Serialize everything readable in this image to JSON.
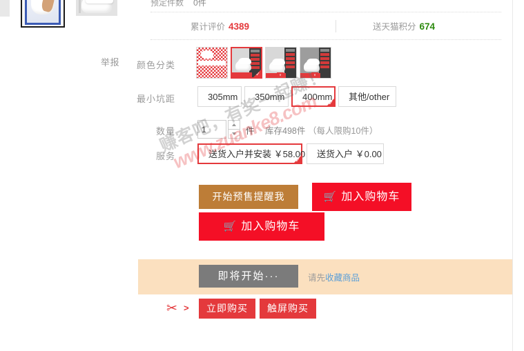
{
  "gallery": {
    "thumbs": [
      {
        "name": "thumbnail-selected-person-toilet",
        "selected": true
      },
      {
        "name": "thumbnail-toilet-side",
        "selected": false
      }
    ]
  },
  "report": {
    "label": "举报"
  },
  "preorder_row": {
    "label": "预定件数",
    "value": "0件"
  },
  "stats": {
    "reviews": {
      "label": "累计评价",
      "value": "4389"
    },
    "points": {
      "label": "送天猫积分",
      "value": "674"
    }
  },
  "color": {
    "label": "颜色分类",
    "options": [
      {
        "alt": "白色款式（图片加载失败）",
        "selected": false,
        "style": "checker"
      },
      {
        "alt": "智能一体式马桶 款式一",
        "selected": true,
        "style": "photo-light"
      },
      {
        "alt": "连体马桶 款式二",
        "selected": false,
        "style": "photo-light"
      },
      {
        "alt": "分体马桶 款式三",
        "selected": false,
        "style": "photo-dark"
      }
    ]
  },
  "pit_distance": {
    "label": "最小坑距",
    "options": [
      {
        "text": "305mm",
        "selected": false
      },
      {
        "text": "350mm",
        "selected": false
      },
      {
        "text": "400mm",
        "selected": true
      },
      {
        "text": "其他/other",
        "selected": false
      }
    ]
  },
  "quantity": {
    "label": "数量",
    "value": "1",
    "placeholder": "1",
    "unit": "件",
    "stock": "库存498件",
    "limit": "（每人限购10件）",
    "increase": "▲",
    "decrease": "▼"
  },
  "service": {
    "label": "服务",
    "options": [
      {
        "text": "送货入户并安装 ￥58.00",
        "selected": true
      },
      {
        "text": "送货入户 ￥0.00",
        "selected": false
      }
    ]
  },
  "actions": {
    "presale_remind": "开始预售提醒我",
    "add_cart_primary": "加入购物车",
    "add_cart_secondary": "加入购物车",
    "cart_icon": "🛒"
  },
  "banner": {
    "soon_button": "即将开始···",
    "hint_prefix": "请先",
    "hint_link": "收藏商品"
  },
  "coupon": {
    "scissors_icon": "✂",
    "arrow": ">",
    "buy_now": "立即购买",
    "touch_buy": "触屏购买"
  },
  "watermark": {
    "line1": "赚客吧，有奖一起赚！",
    "line2": "www.zuanke8.com"
  },
  "colors": {
    "accent_red": "#e4393c",
    "cart_red": "#f40f26",
    "presale_brown": "#bd7d37",
    "banner_orange": "#fbe0bf",
    "soon_gray": "#7b7b7b",
    "points_green": "#2d8a0f",
    "link_blue": "#5b9fd8"
  }
}
